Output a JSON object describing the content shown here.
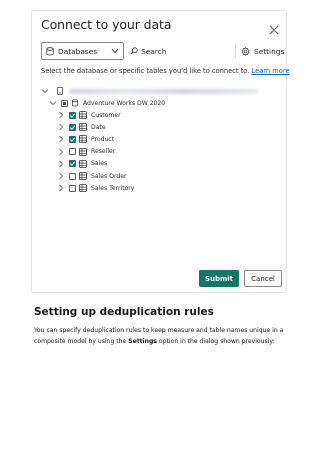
{
  "dialog": {
    "title": "Connect to your data",
    "toolbar": {
      "database_select": "Databases",
      "search_label": "Search",
      "settings_label": "Settings"
    },
    "instructions": "Select the database or specific tables you'd like to connect to.",
    "learn_more": "Learn more",
    "tree": {
      "model_name": "Adventure Works DW 2020",
      "tables": [
        {
          "name": "Customer",
          "checked": true
        },
        {
          "name": "Date",
          "checked": true
        },
        {
          "name": "Product",
          "checked": true
        },
        {
          "name": "Reseller",
          "checked": false
        },
        {
          "name": "Sales",
          "checked": true
        },
        {
          "name": "Sales Order",
          "checked": false
        },
        {
          "name": "Sales Territory",
          "checked": false
        }
      ]
    },
    "buttons": {
      "submit": "Submit",
      "cancel": "Cancel"
    }
  },
  "article": {
    "heading": "Setting up deduplication rules",
    "para_part1": "You can specify deduplication rules to keep measure and table names unique in a composite model by using the ",
    "para_bold": "Settings",
    "para_part2": " option in the dialog shown previously:"
  },
  "colors": {
    "accent": "#117865",
    "link": "#0f6cbd"
  }
}
